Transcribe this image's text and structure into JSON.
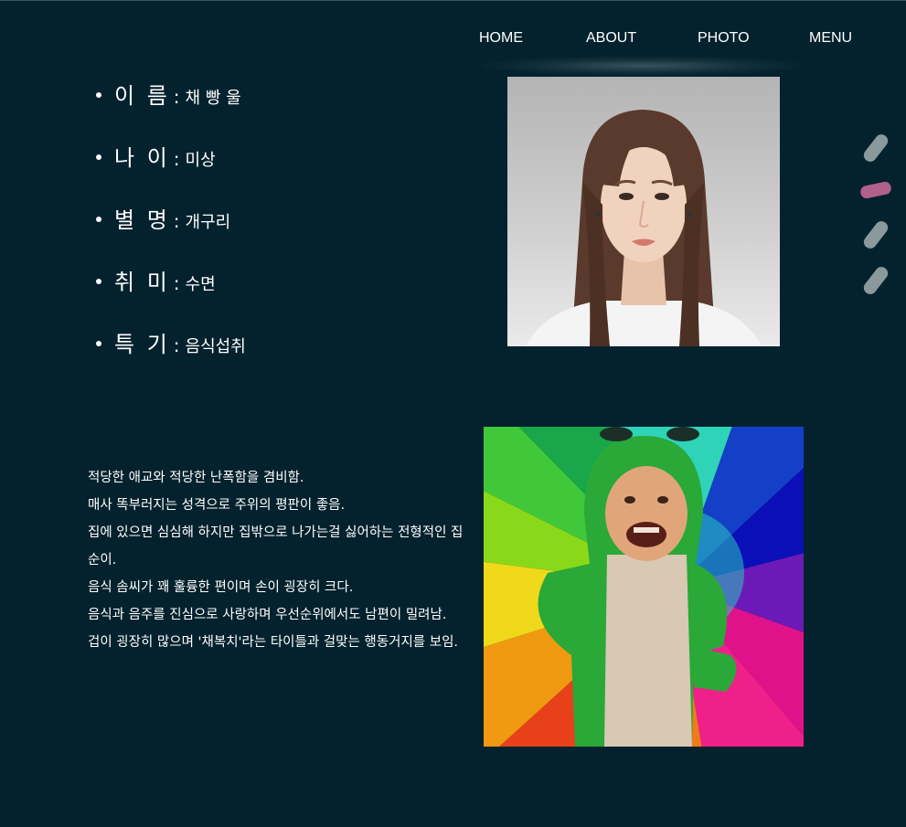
{
  "nav": {
    "items": [
      {
        "label": "HOME"
      },
      {
        "label": "ABOUT"
      },
      {
        "label": "PHOTO"
      },
      {
        "label": "MENU"
      }
    ]
  },
  "profile": {
    "items": [
      {
        "label": "이 름",
        "value": "채 빵 울"
      },
      {
        "label": "나 이",
        "value": "미상"
      },
      {
        "label": "별 명",
        "value": "개구리"
      },
      {
        "label": "취 미",
        "value": "수면"
      },
      {
        "label": "특 기",
        "value": "음식섭취"
      }
    ]
  },
  "description": {
    "lines": [
      "적당한 애교와 적당한 난폭함을 겸비함.",
      "매사 똑부러지는 성격으로 주위의 평판이 좋음.",
      "집에 있으면 심심해 하지만 집밖으로 나가는걸 싫어하는 전형적인 집순이.",
      "음식 솜씨가 꽤 훌륭한 편이며 손이 굉장히 크다.",
      "음식과 음주를 진심으로 사랑하며 우선순위에서도 남편이 밀려남.",
      "겁이 굉장히 많으며 '채복치'라는 타이틀과 걸맞는 행동거지를 보임."
    ]
  },
  "pagination": {
    "active_index": 1,
    "count": 4,
    "active_color": "#b0608a",
    "inactive_color": "#8a9a9c"
  },
  "colors": {
    "background": "#03222e",
    "text": "#ffffff"
  },
  "icons": {
    "profile_photo": "portrait-photo",
    "fun_photo": "frog-costume-photo"
  }
}
